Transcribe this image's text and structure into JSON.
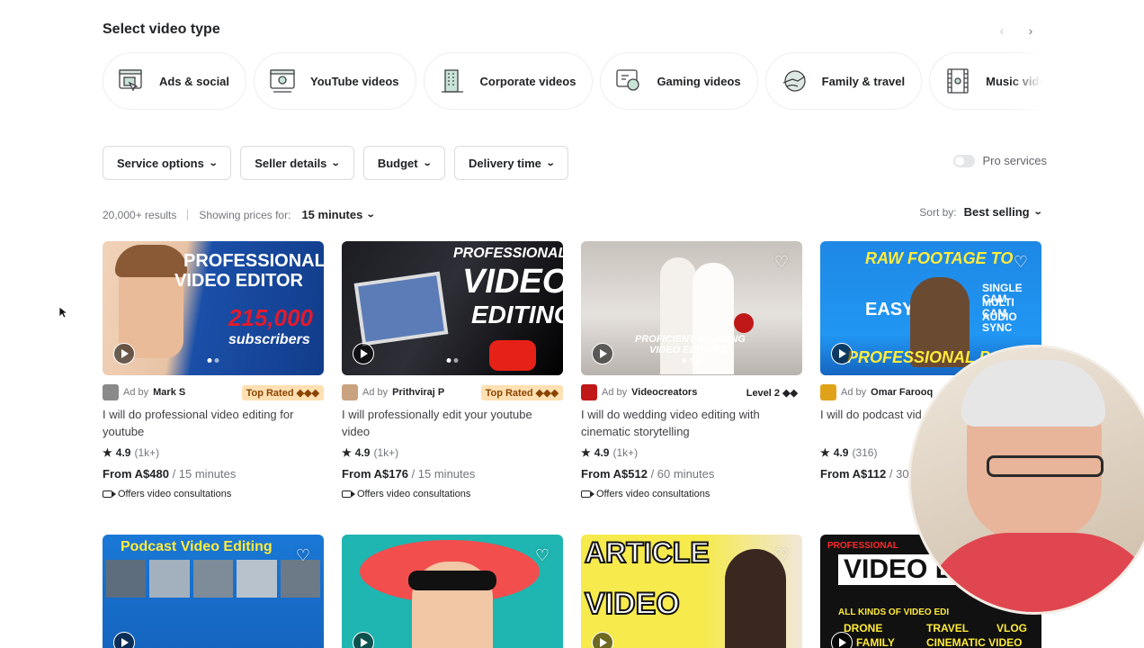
{
  "section": {
    "title": "Select video type"
  },
  "video_types": [
    {
      "label": "Ads & social",
      "icon": "ads-social-icon"
    },
    {
      "label": "YouTube videos",
      "icon": "youtube-videos-icon"
    },
    {
      "label": "Corporate videos",
      "icon": "corporate-videos-icon"
    },
    {
      "label": "Gaming videos",
      "icon": "gaming-videos-icon"
    },
    {
      "label": "Family & travel",
      "icon": "family-travel-icon"
    },
    {
      "label": "Music videos",
      "icon": "music-videos-icon"
    }
  ],
  "filters": [
    {
      "label": "Service options"
    },
    {
      "label": "Seller details"
    },
    {
      "label": "Budget"
    },
    {
      "label": "Delivery time"
    }
  ],
  "pro_services": {
    "label": "Pro services",
    "enabled": false
  },
  "results": {
    "count": "20,000+ results",
    "showing_label": "Showing prices for:",
    "price_mode": "15 minutes"
  },
  "sort": {
    "label": "Sort by:",
    "value": "Best selling"
  },
  "gigs": [
    {
      "ad_label": "Ad by",
      "seller": "Mark S",
      "level": "Top Rated ◆◆◆",
      "title": "I will do professional video editing for youtube",
      "rating": "4.9",
      "reviews": "(1k+)",
      "price": "From A$480",
      "per": "/ 15 minutes",
      "consult": "Offers video consultations",
      "thumb_text": [
        "PROFESSIONAL",
        "VIDEO EDITOR",
        "215,000",
        "subscribers"
      ]
    },
    {
      "ad_label": "Ad by",
      "seller": "Prithviraj P",
      "level": "Top Rated ◆◆◆",
      "title": "I will professionally edit your youtube video",
      "rating": "4.9",
      "reviews": "(1k+)",
      "price": "From A$176",
      "per": "/ 15 minutes",
      "consult": "Offers video consultations",
      "thumb_text": [
        "PROFESSIONAL",
        "VIDEO",
        "EDITING"
      ]
    },
    {
      "ad_label": "Ad by",
      "seller": "Videocreators",
      "level": "Level 2 ◆◆",
      "title": "I will do wedding video editing with cinematic storytelling",
      "rating": "4.9",
      "reviews": "(1k+)",
      "price": "From A$512",
      "per": "/ 60 minutes",
      "consult": "Offers video consultations",
      "thumb_text": [
        "PROFICIENT WEDDING",
        "VIDEO EDITORS"
      ]
    },
    {
      "ad_label": "Ad by",
      "seller": "Omar Farooq",
      "level": "",
      "title": "I will do podcast vid youtube shorts",
      "rating": "4.9",
      "reviews": "(316)",
      "price": "From A$112",
      "per": "/ 30",
      "consult": "",
      "thumb_text": [
        "RAW FOOTAGE TO",
        "EASY",
        "SINGLE CAM",
        "MULTI CAM",
        "AUDIO SYNC",
        "PROFESSIONAL POD"
      ]
    }
  ],
  "row2_thumbs": [
    {
      "text": [
        "Podcast Video Editing"
      ]
    },
    {
      "text": []
    },
    {
      "text": [
        "ARTICLE",
        "VIDEO"
      ]
    },
    {
      "text": [
        "PROFESSIONAL",
        "VIDEO ED",
        "ALL KINDS OF VIDEO EDI",
        "DRONE",
        "TRAVEL",
        "VLOG",
        "FAMILY",
        "CINEMATIC VIDEO"
      ]
    }
  ],
  "colors": {
    "text": "#222325",
    "muted": "#74767e",
    "border": "#dadbdd",
    "top_rated_bg": "#ffe0b3",
    "top_rated_text": "#8a4400"
  }
}
